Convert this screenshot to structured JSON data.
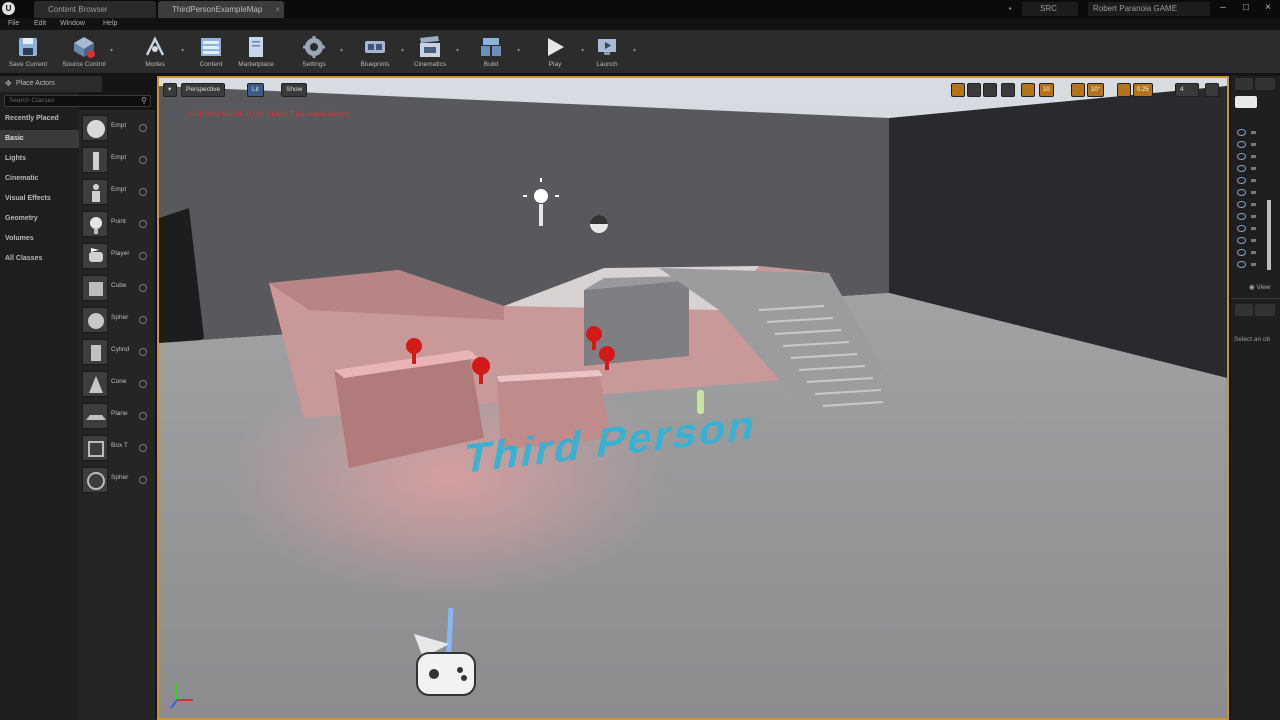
{
  "titlebar": {
    "tabs": [
      {
        "label": "Content Browser"
      },
      {
        "label": "ThirdPersonExampleMap"
      }
    ],
    "source_badge": "SRC",
    "project_name": "Robert Paranoia GAME",
    "window_buttons": [
      "minimize",
      "maximize",
      "close"
    ]
  },
  "menubar": {
    "items": [
      "File",
      "Edit",
      "Window",
      "Help"
    ]
  },
  "toolbar": {
    "buttons": [
      {
        "label": "Save Current",
        "icon": "save-icon"
      },
      {
        "label": "Source Control",
        "icon": "source-control-icon"
      },
      {
        "label": "Modes",
        "icon": "modes-icon"
      },
      {
        "label": "Content",
        "icon": "content-icon"
      },
      {
        "label": "Marketplace",
        "icon": "marketplace-icon"
      },
      {
        "label": "Settings",
        "icon": "settings-icon"
      },
      {
        "label": "Blueprints",
        "icon": "blueprints-icon"
      },
      {
        "label": "Cinematics",
        "icon": "cinematics-icon"
      },
      {
        "label": "Build",
        "icon": "build-icon"
      },
      {
        "label": "Play",
        "icon": "play-icon"
      },
      {
        "label": "Launch",
        "icon": "launch-icon"
      }
    ]
  },
  "modes": {
    "header": "Place Actors",
    "search_placeholder": "Search Classes",
    "categories": [
      {
        "label": "Recently Placed"
      },
      {
        "label": "Basic",
        "active": true
      },
      {
        "label": "Lights"
      },
      {
        "label": "Cinematic"
      },
      {
        "label": "Visual Effects"
      },
      {
        "label": "Geometry"
      },
      {
        "label": "Volumes"
      },
      {
        "label": "All Classes"
      }
    ],
    "items": [
      {
        "label": "Empt"
      },
      {
        "label": "Empt"
      },
      {
        "label": "Empt"
      },
      {
        "label": "Point"
      },
      {
        "label": "Player"
      },
      {
        "label": "Cube"
      },
      {
        "label": "Spher"
      },
      {
        "label": "Cylind"
      },
      {
        "label": "Cone"
      },
      {
        "label": "Plane"
      },
      {
        "label": "Box T"
      },
      {
        "label": "Spher"
      }
    ]
  },
  "viewport": {
    "view_mode": "Perspective",
    "lighting_mode": "Lit",
    "show_label": "Show",
    "status_message": "LIGHTING NEEDS TO BE REBUILT (22 unbuilt objects)",
    "grid_value": "10",
    "angle_value": "10°",
    "scale_value": "0.25",
    "camera_speed": "4",
    "floor_text": "Third Person",
    "accent_color": "#c8962e"
  },
  "outliner": {
    "view_options_label": "View",
    "select_hint": "Select an ob"
  }
}
